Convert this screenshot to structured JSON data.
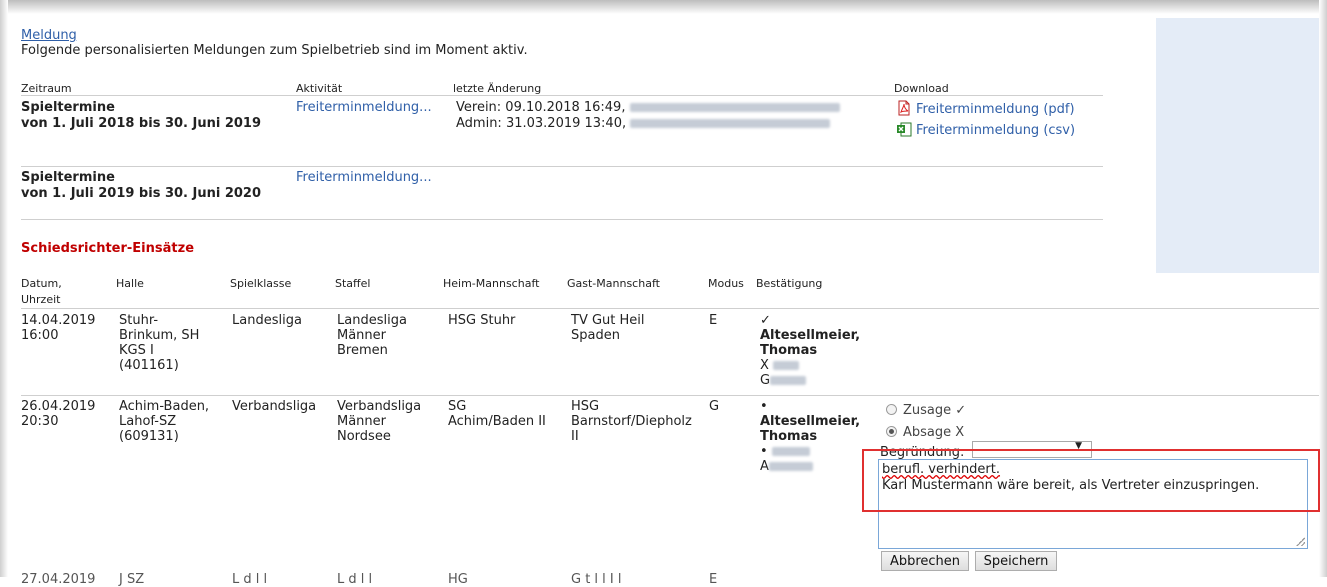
{
  "meldung": {
    "link": "Meldung",
    "intro": "Folgende personalisierten Meldungen zum Spielbetrieb sind im Moment aktiv.",
    "headers": {
      "zeitraum": "Zeitraum",
      "aktivitaet": "Aktivität",
      "letzte_aenderung": "letzte Änderung",
      "download": "Download"
    },
    "rows": [
      {
        "title": "Spieltermine",
        "period": "von 1. Juli 2018 bis 30. Juni 2019",
        "activity": "Freiterminmeldung...",
        "change_1": "Verein: 09.10.2018 16:49,",
        "change_2": "Admin: 31.03.2019 13:40,",
        "downloads": [
          "Freiterminmeldung (pdf)",
          "Freiterminmeldung (csv)"
        ]
      },
      {
        "title": "Spieltermine",
        "period": "von 1. Juli 2019 bis 30. Juni 2020",
        "activity": "Freiterminmeldung..."
      }
    ]
  },
  "schiri": {
    "title": "Schiedsrichter-Einsätze",
    "headers": {
      "datum_1": "Datum,",
      "datum_2": "Uhrzeit",
      "halle": "Halle",
      "spielklasse": "Spielklasse",
      "staffel": "Staffel",
      "heim": "Heim-Mannschaft",
      "gast": "Gast-Mannschaft",
      "modus": "Modus",
      "bestaetigung": "Bestätigung"
    },
    "rows": [
      {
        "date": "14.04.2019",
        "time": "16:00",
        "halle": [
          "Stuhr-",
          "Brinkum, SH",
          "KGS I",
          "(401161)"
        ],
        "spielklasse": "Landesliga",
        "staffel": [
          "Landesliga",
          "Männer",
          "Bremen"
        ],
        "heim": "HSG Stuhr",
        "gast": [
          "TV Gut Heil",
          "Spaden"
        ],
        "modus": "E",
        "confirm_mark": "✓",
        "ref_1": [
          "Altesellmeier,",
          "Thomas"
        ],
        "ref_2_mark": "X",
        "ref_2_partial": "G"
      },
      {
        "date": "26.04.2019",
        "time": "20:30",
        "halle": [
          "Achim-Baden,",
          "Lahof-SZ",
          "(609131)"
        ],
        "spielklasse": "Verbandsliga",
        "staffel": [
          "Verbandsliga",
          "Männer",
          "Nordsee"
        ],
        "heim": [
          "SG",
          "Achim/Baden II"
        ],
        "gast": [
          "HSG",
          "Barnstorf/Diepholz",
          "II"
        ],
        "modus": "G",
        "confirm_mark": "•",
        "ref_1": [
          "Altesellmeier,",
          "Thomas"
        ],
        "ref_2_mark": "•",
        "ref_2_partial": "A"
      }
    ],
    "next_row_partial": [
      "27.04.2019",
      "J    SZ",
      "L  d  l  l",
      "L  d  l  l",
      "HG",
      "G  t  l  l  I  l",
      "E"
    ]
  },
  "form": {
    "zusage_label": "Zusage ✓",
    "absage_label": "Absage X",
    "selected": "absage",
    "begruendung_label": "Begründung:",
    "begruendung_value": "",
    "text_line_1": "berufl. verhindert.",
    "text_line_2": "Karl Mustermann wäre bereit, als Vertreter einzuspringen.",
    "cancel_label": "Abbrechen",
    "save_label": "Speichern"
  },
  "colors": {
    "link": "#2f5fa8",
    "section_title": "#c00000",
    "highlight_box": "#e03030",
    "side_panel": "#e4ecf7"
  }
}
